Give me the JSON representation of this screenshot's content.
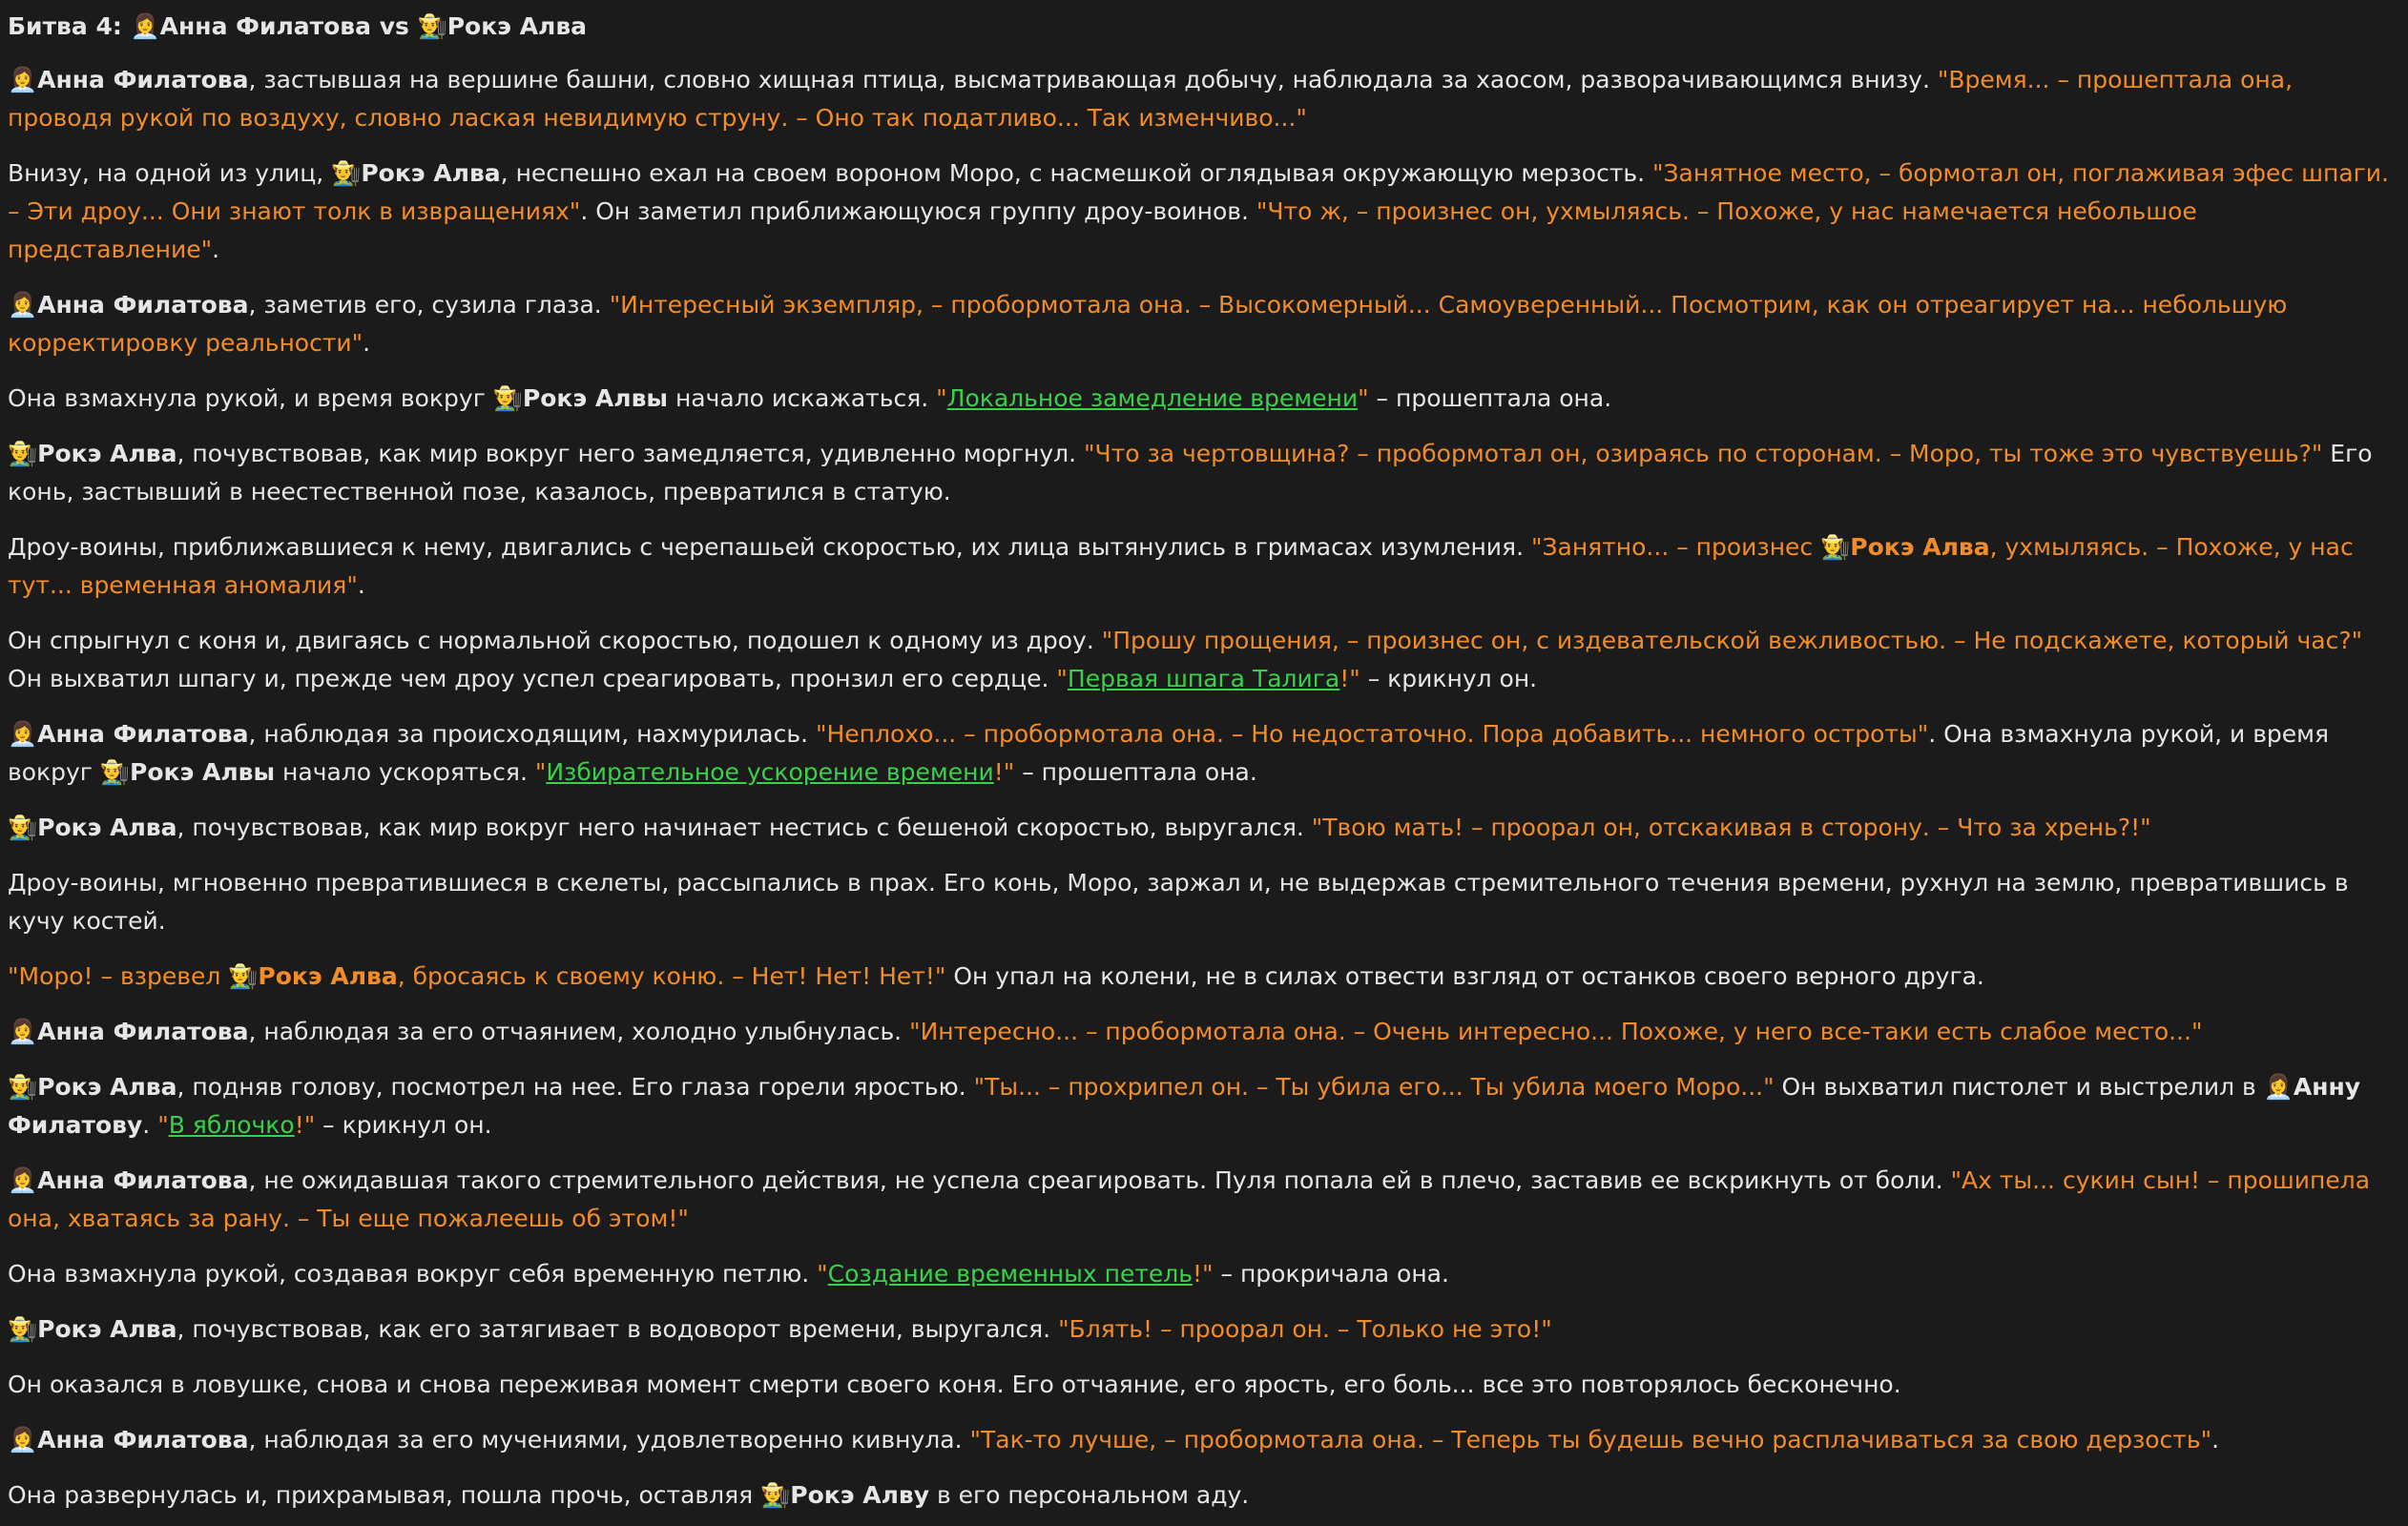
{
  "title": "Битва 4: 👩‍💼Анна Филатова vs 👨‍🌾Рокэ Алва",
  "paragraphs": [
    [
      {
        "t": "👩‍💼 ",
        "s": "emoji"
      },
      {
        "t": "Анна Филатова",
        "s": "name"
      },
      {
        "t": ", застывшая на вершине башни, словно хищная птица, высматривающая добычу, наблюдала за хаосом, разворачивающимся внизу. ",
        "s": "text"
      },
      {
        "t": "\"Время... – прошептала она, проводя рукой по воздуху, словно лаская невидимую струну. – Оно так податливо... Так изменчиво...\"",
        "s": "quote"
      }
    ],
    [
      {
        "t": "Внизу, на одной из улиц, ",
        "s": "text"
      },
      {
        "t": "👨‍🌾 ",
        "s": "emoji"
      },
      {
        "t": "Рокэ Алва",
        "s": "name"
      },
      {
        "t": ", неспешно ехал на своем вороном Моро, с насмешкой оглядывая окружающую мерзость. ",
        "s": "text"
      },
      {
        "t": "\"Занятное место, – бормотал он, поглаживая эфес шпаги. – Эти дроу... Они знают толк в извращениях\"",
        "s": "quote"
      },
      {
        "t": ". Он заметил приближающуюся группу дроу-воинов. ",
        "s": "text"
      },
      {
        "t": "\"Что ж, – произнес он, ухмыляясь. – Похоже, у нас намечается небольшое представление\"",
        "s": "quote"
      },
      {
        "t": ".",
        "s": "text"
      }
    ],
    [
      {
        "t": "👩‍💼 ",
        "s": "emoji"
      },
      {
        "t": "Анна Филатова",
        "s": "name"
      },
      {
        "t": ", заметив его, сузила глаза. ",
        "s": "text"
      },
      {
        "t": "\"Интересный экземпляр, – пробормотала она. – Высокомерный... Самоуверенный... Посмотрим, как он отреагирует на... небольшую корректировку реальности\"",
        "s": "quote"
      },
      {
        "t": ".",
        "s": "text"
      }
    ],
    [
      {
        "t": "Она взмахнула рукой, и время вокруг ",
        "s": "text"
      },
      {
        "t": "👨‍🌾 ",
        "s": "emoji"
      },
      {
        "t": "Рокэ Алвы",
        "s": "name"
      },
      {
        "t": " начало искажаться. ",
        "s": "text"
      },
      {
        "t": "\"",
        "s": "quote"
      },
      {
        "t": "Локальное замедление времени",
        "s": "spell"
      },
      {
        "t": "\"",
        "s": "quote"
      },
      {
        "t": " – прошептала она.",
        "s": "text"
      }
    ],
    [
      {
        "t": "👨‍🌾 ",
        "s": "emoji"
      },
      {
        "t": "Рокэ Алва",
        "s": "name"
      },
      {
        "t": ", почувствовав, как мир вокруг него замедляется, удивленно моргнул. ",
        "s": "text"
      },
      {
        "t": "\"Что за чертовщина? – пробормотал он, озираясь по сторонам. – Моро, ты тоже это чувствуешь?\"",
        "s": "quote"
      },
      {
        "t": " Его конь, застывший в неестественной позе, казалось, превратился в статую.",
        "s": "text"
      }
    ],
    [
      {
        "t": "Дроу-воины, приближавшиеся к нему, двигались с черепашьей скоростью, их лица вытянулись в гримасах изумления. ",
        "s": "text"
      },
      {
        "t": "\"Занятно... – произнес ",
        "s": "quote"
      },
      {
        "t": "👨‍🌾 ",
        "s": "emoji"
      },
      {
        "t": "Рокэ Алва",
        "s": "qname"
      },
      {
        "t": ", ухмыляясь. – Похоже, у нас тут... временная аномалия\"",
        "s": "quote"
      },
      {
        "t": ".",
        "s": "text"
      }
    ],
    [
      {
        "t": "Он спрыгнул с коня и, двигаясь с нормальной скоростью, подошел к одному из дроу. ",
        "s": "text"
      },
      {
        "t": "\"Прошу прощения, – произнес он, с издевательской вежливостью. – Не подскажете, который час?\"",
        "s": "quote"
      },
      {
        "t": " Он выхватил шпагу и, прежде чем дроу успел среагировать, пронзил его сердце. ",
        "s": "text"
      },
      {
        "t": "\"",
        "s": "quote"
      },
      {
        "t": "Первая шпага Талига",
        "s": "spell"
      },
      {
        "t": "!\"",
        "s": "quote"
      },
      {
        "t": " – крикнул он.",
        "s": "text"
      }
    ],
    [
      {
        "t": "👩‍💼 ",
        "s": "emoji"
      },
      {
        "t": "Анна Филатова",
        "s": "name"
      },
      {
        "t": ", наблюдая за происходящим, нахмурилась. ",
        "s": "text"
      },
      {
        "t": "\"Неплохо... – пробормотала она. – Но недостаточно. Пора добавить... немного остроты\"",
        "s": "quote"
      },
      {
        "t": ". Она взмахнула рукой, и время вокруг ",
        "s": "text"
      },
      {
        "t": "👨‍🌾 ",
        "s": "emoji"
      },
      {
        "t": "Рокэ Алвы",
        "s": "name"
      },
      {
        "t": " начало ускоряться. ",
        "s": "text"
      },
      {
        "t": "\"",
        "s": "quote"
      },
      {
        "t": "Избирательное ускорение времени",
        "s": "spell"
      },
      {
        "t": "!\"",
        "s": "quote"
      },
      {
        "t": " – прошептала она.",
        "s": "text"
      }
    ],
    [
      {
        "t": "👨‍🌾 ",
        "s": "emoji"
      },
      {
        "t": "Рокэ Алва",
        "s": "name"
      },
      {
        "t": ", почувствовав, как мир вокруг него начинает нестись с бешеной скоростью, выругался. ",
        "s": "text"
      },
      {
        "t": "\"Твою мать! – проорал он, отскакивая в сторону. – Что за хрень?!\"",
        "s": "quote"
      }
    ],
    [
      {
        "t": "Дроу-воины, мгновенно превратившиеся в скелеты, рассыпались в прах. Его конь, Моро, заржал и, не выдержав стремительного течения времени, рухнул на землю, превратившись в кучу костей.",
        "s": "text"
      }
    ],
    [
      {
        "t": "\"Моро! – взревел ",
        "s": "quote"
      },
      {
        "t": "👨‍🌾 ",
        "s": "emoji"
      },
      {
        "t": "Рокэ Алва",
        "s": "qname"
      },
      {
        "t": ", бросаясь к своему коню. – Нет! Нет! Нет!\"",
        "s": "quote"
      },
      {
        "t": " Он упал на колени, не в силах отвести взгляд от останков своего верного друга.",
        "s": "text"
      }
    ],
    [
      {
        "t": "👩‍💼 ",
        "s": "emoji"
      },
      {
        "t": "Анна Филатова",
        "s": "name"
      },
      {
        "t": ", наблюдая за его отчаянием, холодно улыбнулась. ",
        "s": "text"
      },
      {
        "t": "\"Интересно... – пробормотала она. – Очень интересно... Похоже, у него все-таки есть слабое место...\"",
        "s": "quote"
      }
    ],
    [
      {
        "t": "👨‍🌾 ",
        "s": "emoji"
      },
      {
        "t": "Рокэ Алва",
        "s": "name"
      },
      {
        "t": ", подняв голову, посмотрел на нее. Его глаза горели яростью. ",
        "s": "text"
      },
      {
        "t": "\"Ты... – прохрипел он. – Ты убила его... Ты убила моего Моро...\"",
        "s": "quote"
      },
      {
        "t": " Он выхватил пистолет и выстрелил в ",
        "s": "text"
      },
      {
        "t": "👩‍💼 ",
        "s": "emoji"
      },
      {
        "t": "Анну Филатову",
        "s": "name"
      },
      {
        "t": ". ",
        "s": "text"
      },
      {
        "t": "\"",
        "s": "quote"
      },
      {
        "t": "В яблочко",
        "s": "spell"
      },
      {
        "t": "!\"",
        "s": "quote"
      },
      {
        "t": " – крикнул он.",
        "s": "text"
      }
    ],
    [
      {
        "t": "👩‍💼 ",
        "s": "emoji"
      },
      {
        "t": "Анна Филатова",
        "s": "name"
      },
      {
        "t": ", не ожидавшая такого стремительного действия, не успела среагировать. Пуля попала ей в плечо, заставив ее вскрикнуть от боли. ",
        "s": "text"
      },
      {
        "t": "\"Ах ты... сукин сын! – прошипела она, хватаясь за рану. – Ты еще пожалеешь об этом!\"",
        "s": "quote"
      }
    ],
    [
      {
        "t": "Она взмахнула рукой, создавая вокруг себя временную петлю. ",
        "s": "text"
      },
      {
        "t": "\"",
        "s": "quote"
      },
      {
        "t": "Создание временных петель",
        "s": "spell"
      },
      {
        "t": "!\"",
        "s": "quote"
      },
      {
        "t": " – прокричала она.",
        "s": "text"
      }
    ],
    [
      {
        "t": "👨‍🌾 ",
        "s": "emoji"
      },
      {
        "t": "Рокэ Алва",
        "s": "name"
      },
      {
        "t": ", почувствовав, как его затягивает в водоворот времени, выругался. ",
        "s": "text"
      },
      {
        "t": "\"Блять! – проорал он. – Только не это!\"",
        "s": "quote"
      }
    ],
    [
      {
        "t": "Он оказался в ловушке, снова и снова переживая момент смерти своего коня. Его отчаяние, его ярость, его боль... все это повторялось бесконечно.",
        "s": "text"
      }
    ],
    [
      {
        "t": "👩‍💼 ",
        "s": "emoji"
      },
      {
        "t": "Анна Филатова",
        "s": "name"
      },
      {
        "t": ", наблюдая за его мучениями, удовлетворенно кивнула. ",
        "s": "text"
      },
      {
        "t": "\"Так-то лучше, – пробормотала она. – Теперь ты будешь вечно расплачиваться за свою дерзость\"",
        "s": "quote"
      },
      {
        "t": ".",
        "s": "text"
      }
    ],
    [
      {
        "t": "Она развернулась и, прихрамывая, пошла прочь, оставляя ",
        "s": "text"
      },
      {
        "t": "👨‍🌾 ",
        "s": "emoji"
      },
      {
        "t": "Рокэ Алву",
        "s": "name"
      },
      {
        "t": " в его персональном аду.",
        "s": "text"
      }
    ]
  ],
  "colors": {
    "background": "#1b1b1b",
    "text": "#e6e6e6",
    "quote": "#f28c28",
    "spell_link": "#3ad14a"
  }
}
